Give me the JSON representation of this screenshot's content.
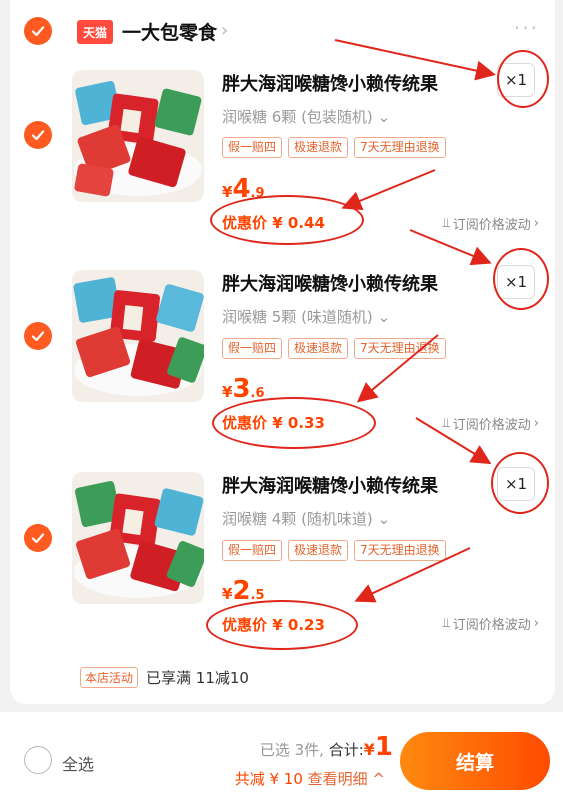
{
  "store": {
    "logo_text": "天猫",
    "name": "一大包零食",
    "more": "···"
  },
  "items": [
    {
      "title": "胖大海润喉糖馋小赖传统果",
      "variant": "润喉糖 6颗 (包装随机)",
      "tags": [
        "假一赔四",
        "极速退款",
        "7天无理由退换"
      ],
      "price_symbol": "¥",
      "price_int": "4",
      "price_dec": ".9",
      "discount": "优惠价 ¥ 0.44",
      "sub_link": "订阅价格波动",
      "qty": "×1"
    },
    {
      "title": "胖大海润喉糖馋小赖传统果",
      "variant": "润喉糖 5颗 (味道随机)",
      "tags": [
        "假一赔四",
        "极速退款",
        "7天无理由退换"
      ],
      "price_symbol": "¥",
      "price_int": "3",
      "price_dec": ".6",
      "discount": "优惠价 ¥ 0.33",
      "sub_link": "订阅价格波动",
      "qty": "×1"
    },
    {
      "title": "胖大海润喉糖馋小赖传统果",
      "variant": "润喉糖 4颗 (随机味道)",
      "tags": [
        "假一赔四",
        "极速退款",
        "7天无理由退换"
      ],
      "price_symbol": "¥",
      "price_int": "2",
      "price_dec": ".5",
      "discount": "优惠价 ¥ 0.23",
      "sub_link": "订阅价格波动",
      "qty": "×1"
    }
  ],
  "promo": {
    "tag": "本店活动",
    "text": "已享满 11减10"
  },
  "footer": {
    "select_all": "全选",
    "selected_count": "已选 3件,",
    "total_label": "合计:",
    "total_symbol": "¥",
    "total_value": "1",
    "savings": "共减 ¥ 10",
    "detail_link": "查看明细 ^",
    "checkout": "结算"
  },
  "colors": {
    "accent": "#ff5a1f",
    "price": "#ff4400",
    "annotation": "#e0261b"
  }
}
